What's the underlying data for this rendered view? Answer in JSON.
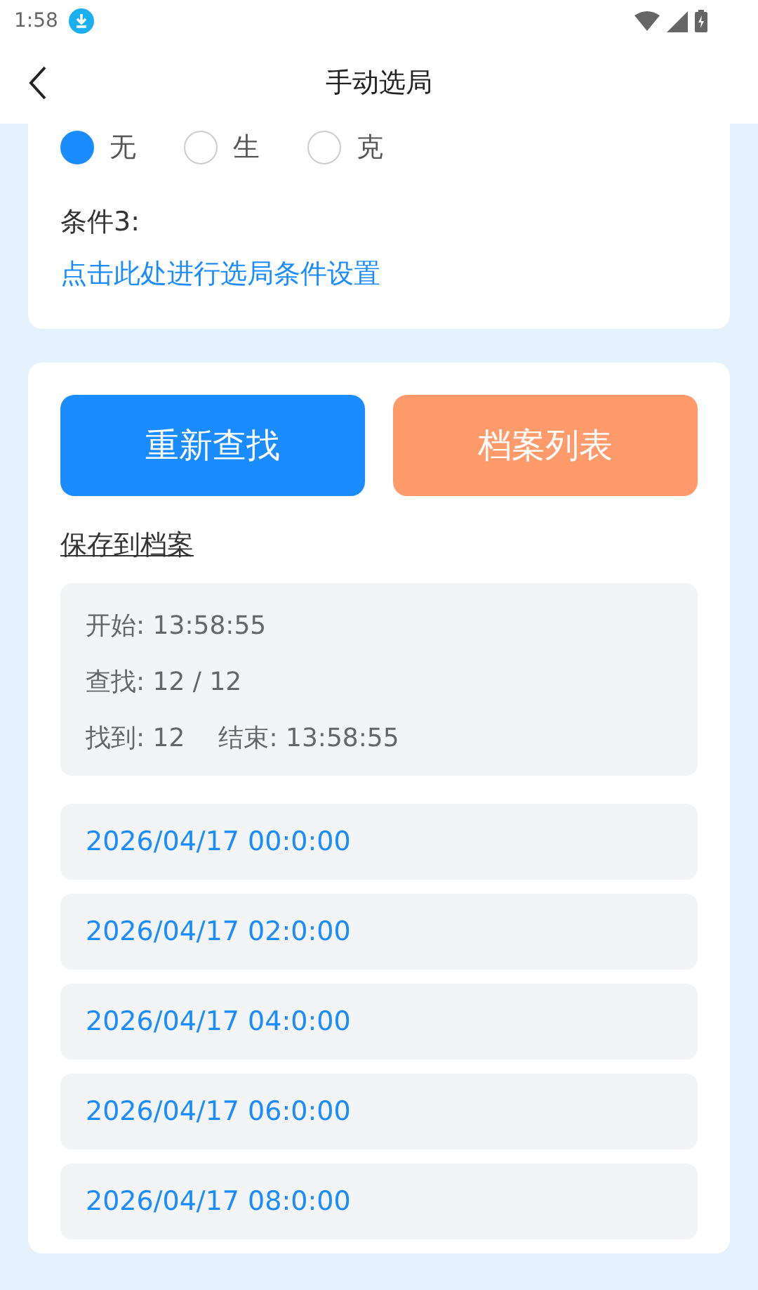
{
  "status_bar": {
    "time": "1:58"
  },
  "header": {
    "title": "手动选局"
  },
  "radios": [
    {
      "label": "无",
      "selected": true
    },
    {
      "label": "生",
      "selected": false
    },
    {
      "label": "克",
      "selected": false
    }
  ],
  "condition": {
    "label": "条件3:",
    "link": "点击此处进行选局条件设置"
  },
  "buttons": [
    {
      "label": "重新查找",
      "kind": "primary"
    },
    {
      "label": "档案列表",
      "kind": "secondary"
    }
  ],
  "save_link": "保存到档案",
  "info": {
    "lines": [
      [
        "开始: 13:58:55"
      ],
      [
        "查找: 12 / 12"
      ],
      [
        "找到: 12",
        "结束: 13:58:55"
      ]
    ]
  },
  "results": [
    "2026/04/17 00:0:00",
    "2026/04/17 02:0:00",
    "2026/04/17 04:0:00",
    "2026/04/17 06:0:00",
    "2026/04/17 08:0:00"
  ]
}
